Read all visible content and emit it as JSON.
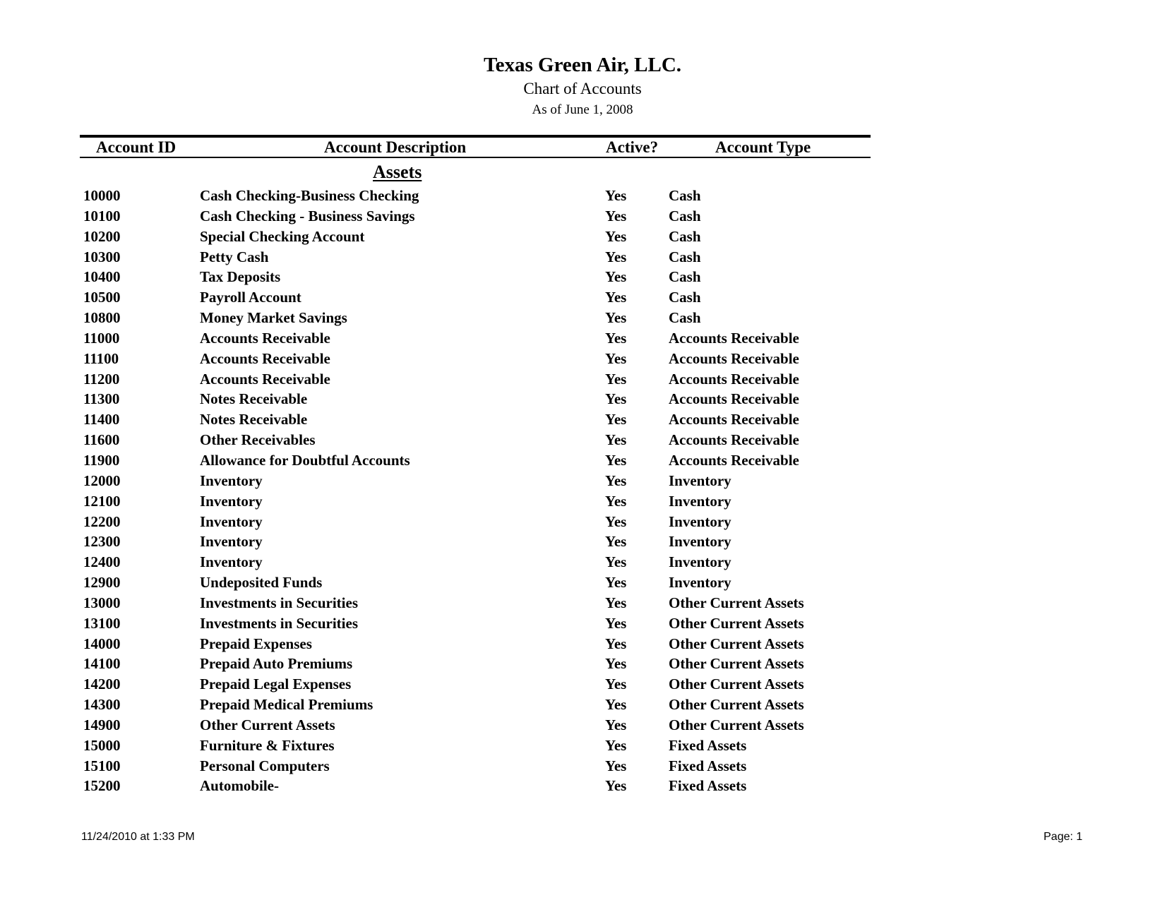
{
  "report": {
    "company": "Texas Green Air, LLC.",
    "title": "Chart of Accounts",
    "as_of": "As of June 1, 2008"
  },
  "columns": {
    "id": "Account ID",
    "description": "Account Description",
    "active": "Active?",
    "type": "Account Type"
  },
  "section": "Assets",
  "rows": [
    {
      "id": "10000",
      "description": "Cash Checking-Business Checking",
      "active": "Yes",
      "type": "Cash"
    },
    {
      "id": "10100",
      "description": "Cash Checking - Business Savings",
      "active": "Yes",
      "type": "Cash"
    },
    {
      "id": "10200",
      "description": "Special Checking Account",
      "active": "Yes",
      "type": "Cash"
    },
    {
      "id": "10300",
      "description": "Petty Cash",
      "active": "Yes",
      "type": "Cash"
    },
    {
      "id": "10400",
      "description": "Tax Deposits",
      "active": "Yes",
      "type": "Cash"
    },
    {
      "id": "10500",
      "description": "Payroll Account",
      "active": "Yes",
      "type": "Cash"
    },
    {
      "id": "10800",
      "description": "Money Market Savings",
      "active": "Yes",
      "type": "Cash"
    },
    {
      "id": "11000",
      "description": "Accounts Receivable",
      "active": "Yes",
      "type": "Accounts Receivable"
    },
    {
      "id": "11100",
      "description": "Accounts Receivable",
      "active": "Yes",
      "type": "Accounts Receivable"
    },
    {
      "id": "11200",
      "description": "Accounts Receivable",
      "active": "Yes",
      "type": "Accounts Receivable"
    },
    {
      "id": "11300",
      "description": "Notes Receivable",
      "active": "Yes",
      "type": "Accounts Receivable"
    },
    {
      "id": "11400",
      "description": "Notes Receivable",
      "active": "Yes",
      "type": "Accounts Receivable"
    },
    {
      "id": "11600",
      "description": "Other Receivables",
      "active": "Yes",
      "type": "Accounts Receivable"
    },
    {
      "id": "11900",
      "description": "Allowance for Doubtful Accounts",
      "active": "Yes",
      "type": "Accounts Receivable"
    },
    {
      "id": "12000",
      "description": "Inventory",
      "active": "Yes",
      "type": "Inventory"
    },
    {
      "id": "12100",
      "description": "Inventory",
      "active": "Yes",
      "type": "Inventory"
    },
    {
      "id": "12200",
      "description": "Inventory",
      "active": "Yes",
      "type": "Inventory"
    },
    {
      "id": "12300",
      "description": "Inventory",
      "active": "Yes",
      "type": "Inventory"
    },
    {
      "id": "12400",
      "description": "Inventory",
      "active": "Yes",
      "type": "Inventory"
    },
    {
      "id": "12900",
      "description": "Undeposited Funds",
      "active": "Yes",
      "type": "Inventory"
    },
    {
      "id": "13000",
      "description": "Investments in Securities",
      "active": "Yes",
      "type": "Other Current Assets"
    },
    {
      "id": "13100",
      "description": "Investments in Securities",
      "active": "Yes",
      "type": "Other Current Assets"
    },
    {
      "id": "14000",
      "description": "Prepaid Expenses",
      "active": "Yes",
      "type": "Other Current Assets"
    },
    {
      "id": "14100",
      "description": "Prepaid Auto Premiums",
      "active": "Yes",
      "type": "Other Current Assets"
    },
    {
      "id": "14200",
      "description": "Prepaid Legal Expenses",
      "active": "Yes",
      "type": "Other Current Assets"
    },
    {
      "id": "14300",
      "description": "Prepaid Medical Premiums",
      "active": "Yes",
      "type": "Other Current Assets"
    },
    {
      "id": "14900",
      "description": "Other Current Assets",
      "active": "Yes",
      "type": "Other Current Assets"
    },
    {
      "id": "15000",
      "description": "Furniture & Fixtures",
      "active": "Yes",
      "type": "Fixed Assets"
    },
    {
      "id": "15100",
      "description": "Personal Computers",
      "active": "Yes",
      "type": "Fixed Assets"
    },
    {
      "id": "15200",
      "description": "Automobile-",
      "active": "Yes",
      "type": "Fixed Assets"
    }
  ],
  "footer": {
    "printed": "11/24/2010 at 1:33 PM",
    "page": "Page: 1"
  }
}
